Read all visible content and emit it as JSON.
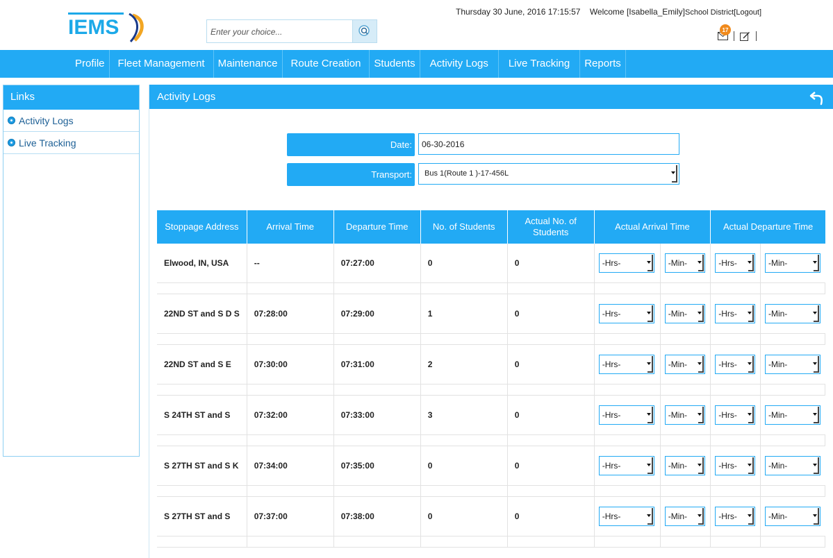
{
  "header": {
    "logo_text": "IEMS",
    "search_placeholder": "Enter your choice...",
    "datetime": "Thursday 30 June, 2016 17:15:57",
    "welcome": "Welcome [Isabella_Emily]",
    "role": "School District",
    "logout": "[Logout]",
    "notification_count": "17"
  },
  "nav": {
    "items": [
      {
        "label": "Profile"
      },
      {
        "label": "Fleet Management"
      },
      {
        "label": "Maintenance"
      },
      {
        "label": "Route Creation"
      },
      {
        "label": "Students"
      },
      {
        "label": "Activity Logs"
      },
      {
        "label": "Live Tracking"
      },
      {
        "label": "Reports"
      }
    ]
  },
  "sidebar": {
    "title": "Links",
    "items": [
      {
        "label": "Activity Logs"
      },
      {
        "label": "Live Tracking"
      }
    ]
  },
  "main": {
    "title": "Activity Logs",
    "date_label": "Date:",
    "date_value": "06-30-2016",
    "transport_label": "Transport:",
    "transport_value": "Bus 1(Route 1 )-17-456L"
  },
  "table": {
    "headers": [
      "Stoppage Address",
      "Arrival Time",
      "Departure Time",
      "No. of Students",
      "Actual No. of Students",
      "Actual Arrival Time",
      "Actual Departure Time"
    ],
    "hrs_placeholder": "-Hrs-",
    "min_placeholder": "-Min-",
    "rows": [
      {
        "address": "Elwood, IN, USA",
        "arrival": "--",
        "departure": "07:27:00",
        "students": "0",
        "actual": "0"
      },
      {
        "address": "22ND ST and S D S",
        "arrival": "07:28:00",
        "departure": "07:29:00",
        "students": "1",
        "actual": "0"
      },
      {
        "address": "22ND ST and  S E",
        "arrival": "07:30:00",
        "departure": "07:31:00",
        "students": "2",
        "actual": "0"
      },
      {
        "address": "S 24TH ST and  S",
        "arrival": "07:32:00",
        "departure": "07:33:00",
        "students": "3",
        "actual": "0"
      },
      {
        "address": "S 27TH ST and S K",
        "arrival": "07:34:00",
        "departure": "07:35:00",
        "students": "0",
        "actual": "0"
      },
      {
        "address": "S 27TH ST and  S",
        "arrival": "07:37:00",
        "departure": "07:38:00",
        "students": "0",
        "actual": "0"
      }
    ]
  },
  "colors": {
    "accent": "#22aaf4",
    "badge": "#f08a1c",
    "link": "#1c5f95"
  }
}
